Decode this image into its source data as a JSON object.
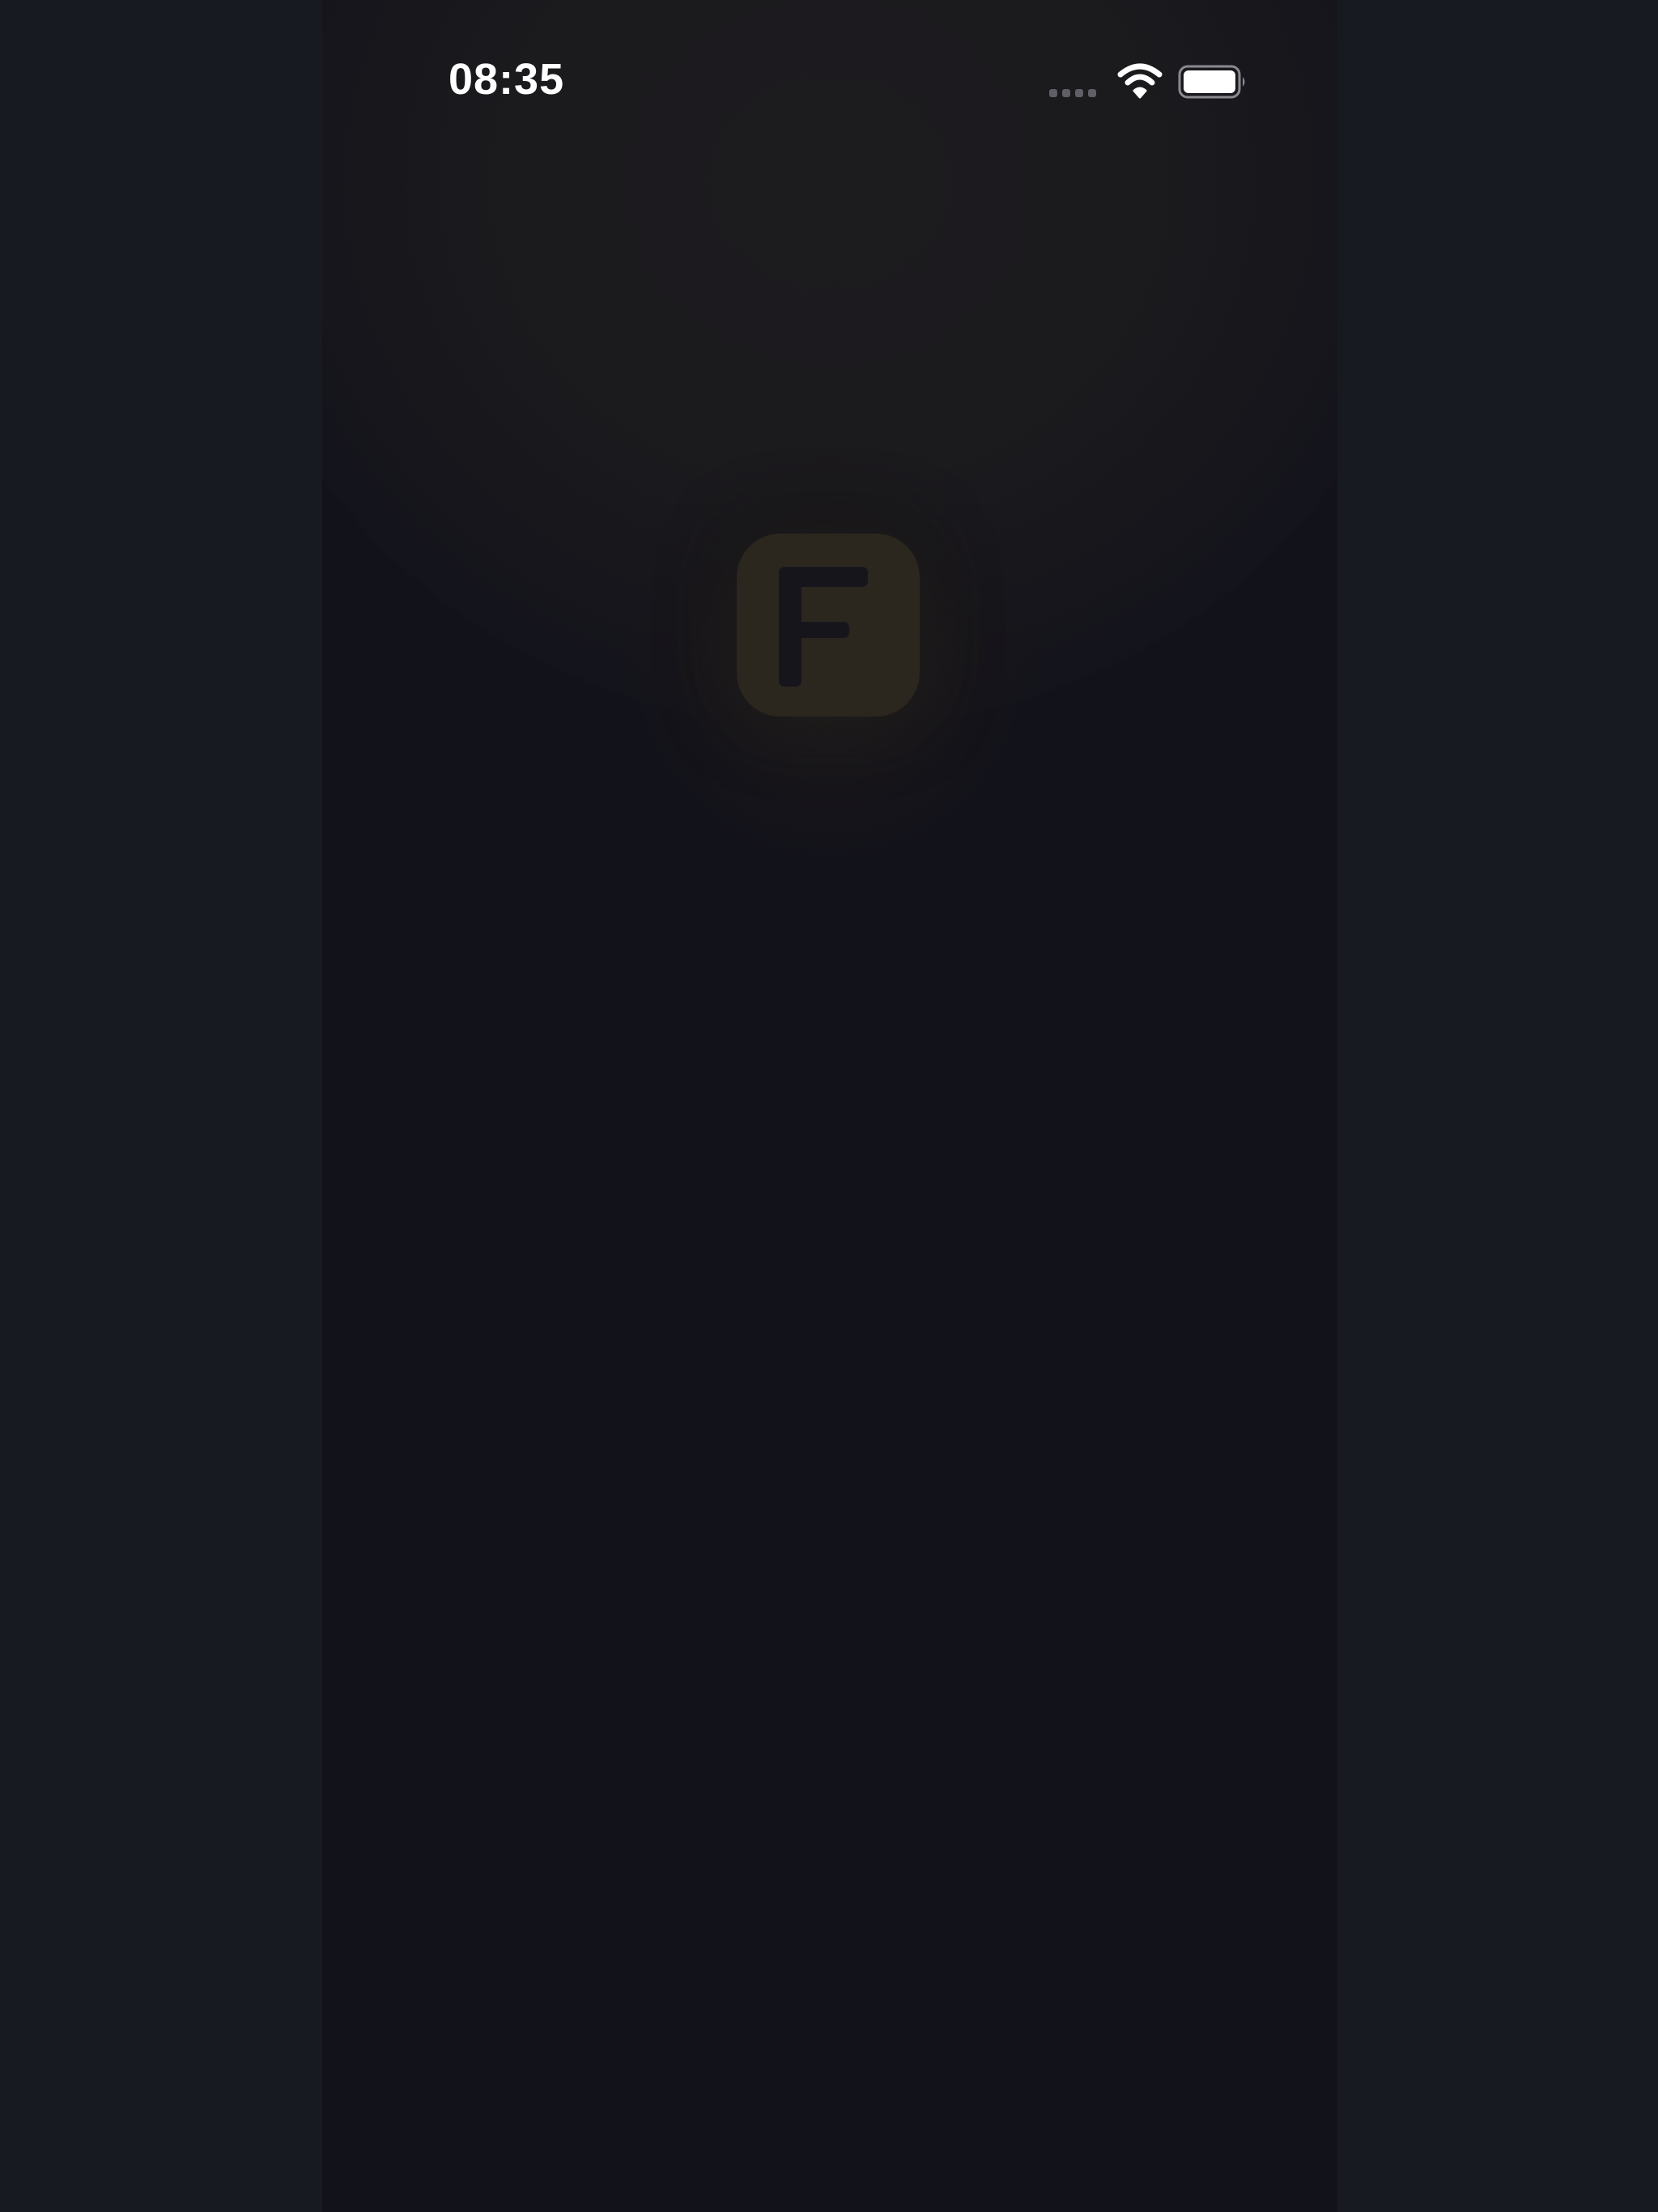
{
  "status_bar": {
    "time": "08:35",
    "signal_icon": "cellular-signal-dots-icon",
    "wifi_icon": "wifi-icon",
    "battery_icon": "battery-full-icon"
  },
  "splash": {
    "app_icon_letter": "F",
    "app_icon_bg": "#2b261e",
    "app_icon_letter_color": "#17151c"
  },
  "colors": {
    "outer_background": "#181a22",
    "screen_background": "#12121b",
    "status_text": "#ffffff"
  }
}
